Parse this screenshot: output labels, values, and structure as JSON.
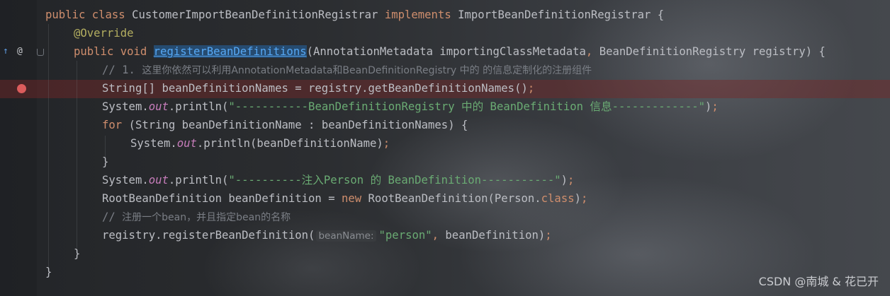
{
  "editor": {
    "code_lines": [
      {
        "parts": [
          {
            "t": "public class ",
            "c": "kw"
          },
          {
            "t": "CustomerImportBeanDefinitionRegistrar ",
            "c": "type"
          },
          {
            "t": "implements ",
            "c": "kw"
          },
          {
            "t": "ImportBeanDefinitionRegistrar {",
            "c": "type"
          }
        ]
      },
      {
        "indent": 1,
        "parts": [
          {
            "t": "@Override",
            "c": "ann"
          }
        ]
      },
      {
        "indent": 1,
        "parts": [
          {
            "t": "public void ",
            "c": "kw"
          },
          {
            "t": "registerBeanDefinitions",
            "c": "method-hl"
          },
          {
            "t": "(AnnotationMetadata importingClassMetadata",
            "c": "type"
          },
          {
            "t": ", ",
            "c": "kw"
          },
          {
            "t": "BeanDefinitionRegistry registry) {",
            "c": "type"
          }
        ]
      },
      {
        "indent": 2,
        "parts": [
          {
            "t": "// 1. ",
            "c": "cmt"
          },
          {
            "t": "这里你依然可以利用AnnotationMetadata和BeanDefinitionRegistry 中的 的信息定制化的注册组件",
            "c": "cmt cmt-cn"
          }
        ]
      },
      {
        "indent": 2,
        "parts": [
          {
            "t": "String[] beanDefinitionNames = registry.getBeanDefinitionNames()",
            "c": "type"
          },
          {
            "t": ";",
            "c": "kw"
          }
        ]
      },
      {
        "indent": 2,
        "parts": [
          {
            "t": "System.",
            "c": "type"
          },
          {
            "t": "out",
            "c": "static"
          },
          {
            "t": ".println(",
            "c": "type"
          },
          {
            "t": "\"-----------BeanDefinitionRegistry 中的 BeanDefinition 信息-------------\"",
            "c": "str"
          },
          {
            "t": ")",
            "c": "type"
          },
          {
            "t": ";",
            "c": "kw"
          }
        ]
      },
      {
        "indent": 2,
        "parts": [
          {
            "t": "for ",
            "c": "kw"
          },
          {
            "t": "(String beanDefinitionName : beanDefinitionNames) {",
            "c": "type"
          }
        ]
      },
      {
        "indent": 3,
        "parts": [
          {
            "t": "System.",
            "c": "type"
          },
          {
            "t": "out",
            "c": "static"
          },
          {
            "t": ".println(beanDefinitionName)",
            "c": "type"
          },
          {
            "t": ";",
            "c": "kw"
          }
        ]
      },
      {
        "indent": 2,
        "parts": [
          {
            "t": "}",
            "c": "type"
          }
        ]
      },
      {
        "indent": 2,
        "parts": [
          {
            "t": "System.",
            "c": "type"
          },
          {
            "t": "out",
            "c": "static"
          },
          {
            "t": ".println(",
            "c": "type"
          },
          {
            "t": "\"----------注入Person 的 BeanDefinition-----------\"",
            "c": "str"
          },
          {
            "t": ")",
            "c": "type"
          },
          {
            "t": ";",
            "c": "kw"
          }
        ]
      },
      {
        "indent": 2,
        "parts": [
          {
            "t": "RootBeanDefinition beanDefinition = ",
            "c": "type"
          },
          {
            "t": "new ",
            "c": "kw"
          },
          {
            "t": "RootBeanDefinition(Person.",
            "c": "type"
          },
          {
            "t": "class",
            "c": "kw"
          },
          {
            "t": ")",
            "c": "type"
          },
          {
            "t": ";",
            "c": "kw"
          }
        ]
      },
      {
        "indent": 2,
        "parts": [
          {
            "t": "// ",
            "c": "cmt"
          },
          {
            "t": "注册一个bean，并且指定bean的名称",
            "c": "cmt cmt-cn"
          }
        ]
      },
      {
        "indent": 2,
        "parts": [
          {
            "t": "registry.registerBeanDefinition(",
            "c": "type"
          },
          {
            "t": "beanName:",
            "c": "hint"
          },
          {
            "t": "\"person\"",
            "c": "str"
          },
          {
            "t": ", ",
            "c": "kw"
          },
          {
            "t": "beanDefinition)",
            "c": "type"
          },
          {
            "t": ";",
            "c": "kw"
          }
        ]
      },
      {
        "indent": 1,
        "parts": [
          {
            "t": "}",
            "c": "type"
          }
        ]
      },
      {
        "parts": [
          {
            "t": "}",
            "c": "type"
          }
        ]
      }
    ]
  },
  "gutter": {
    "override_marker": "↑",
    "annotation_marker": "@"
  },
  "watermark": "CSDN @南城 & 花已开",
  "colors": {
    "keyword": "#cf8e6d",
    "annotation": "#b3ae60",
    "string": "#6aab73",
    "comment": "#7a7e85",
    "static_field": "#c77dbb",
    "breakpoint": "#db5c5c"
  }
}
